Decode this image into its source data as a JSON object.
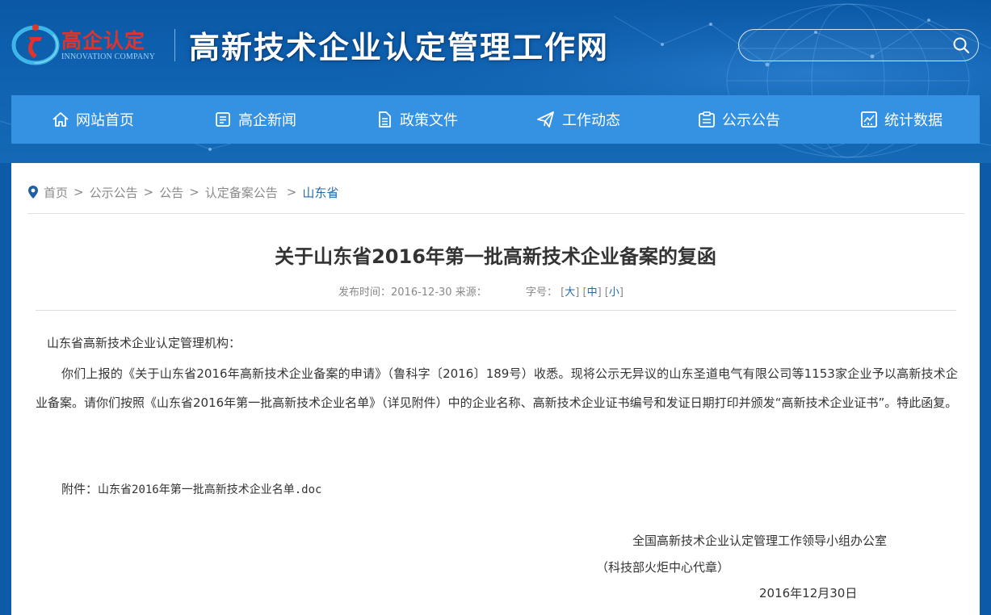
{
  "header": {
    "logo_text": "高企认定",
    "logo_subtext": "INNOVATION COMPANY",
    "site_title": "高新技术企业认定管理工作网",
    "search_placeholder": ""
  },
  "nav": {
    "items": [
      {
        "label": "网站首页",
        "icon": "home-icon"
      },
      {
        "label": "高企新闻",
        "icon": "news-icon"
      },
      {
        "label": "政策文件",
        "icon": "document-icon"
      },
      {
        "label": "工作动态",
        "icon": "send-icon"
      },
      {
        "label": "公示公告",
        "icon": "notice-icon"
      },
      {
        "label": "统计数据",
        "icon": "chart-icon"
      }
    ]
  },
  "breadcrumb": {
    "items": [
      "首页",
      "公示公告",
      "公告",
      "认定备案公告"
    ],
    "current": "山东省",
    "separator": ">"
  },
  "article": {
    "title": "关于山东省2016年第一批高新技术企业备案的复函",
    "publish_label": "发布时间：",
    "publish_date": "2016-12-30",
    "source_label": "来源：",
    "source_value": "",
    "font_size_label": "字号：",
    "font_large": "大",
    "font_medium": "中",
    "font_small": "小",
    "salutation": "山东省高新技术企业认定管理机构：",
    "paragraph": "你们上报的《关于山东省2016年高新技术企业备案的申请》（鲁科字〔2016〕189号）收悉。现将公示无异议的山东圣道电气有限公司等1153家企业予以高新技术企业备案。请你们按照《山东省2016年第一批高新技术企业名单》（详见附件）中的企业名称、高新技术企业证书编号和发证日期打印并颁发“高新技术企业证书”。特此函复。",
    "attachment_label": "附件：",
    "attachment_link": "山东省2016年第一批高新技术企业名单.doc",
    "signature_org": "全国高新技术企业认定管理工作领导小组办公室",
    "signature_note": "（科技部火炬中心代章）",
    "signature_date": "2016年12月30日"
  },
  "colors": {
    "header_bg": "#0f62b0",
    "nav_bg": "#3591e2",
    "link_blue": "#2069b3",
    "logo_red": "#e0332a"
  }
}
